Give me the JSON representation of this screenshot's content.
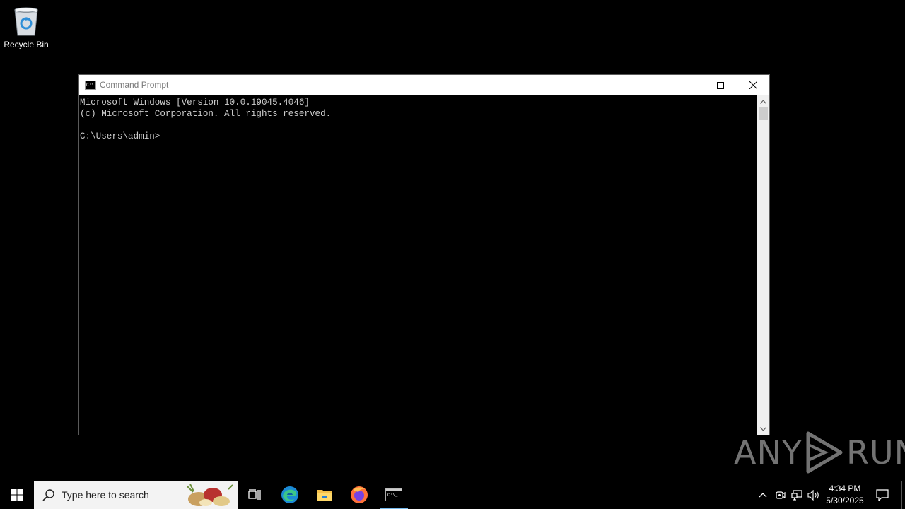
{
  "desktop": {
    "recycle_bin_label": "Recycle Bin"
  },
  "window": {
    "title": "Command Prompt",
    "console_lines": [
      "Microsoft Windows [Version 10.0.19045.4046]",
      "(c) Microsoft Corporation. All rights reserved.",
      "",
      "C:\\Users\\admin>"
    ]
  },
  "watermark": {
    "left": "ANY",
    "right": "RUN"
  },
  "taskbar": {
    "search_placeholder": "Type here to search",
    "apps": [
      "task-view",
      "edge",
      "file-explorer",
      "firefox",
      "command-prompt"
    ],
    "clock_time": "4:34 PM",
    "clock_date": "5/30/2025"
  },
  "colors": {
    "console_text": "#cccccc",
    "active_indicator": "#76b9ed"
  }
}
